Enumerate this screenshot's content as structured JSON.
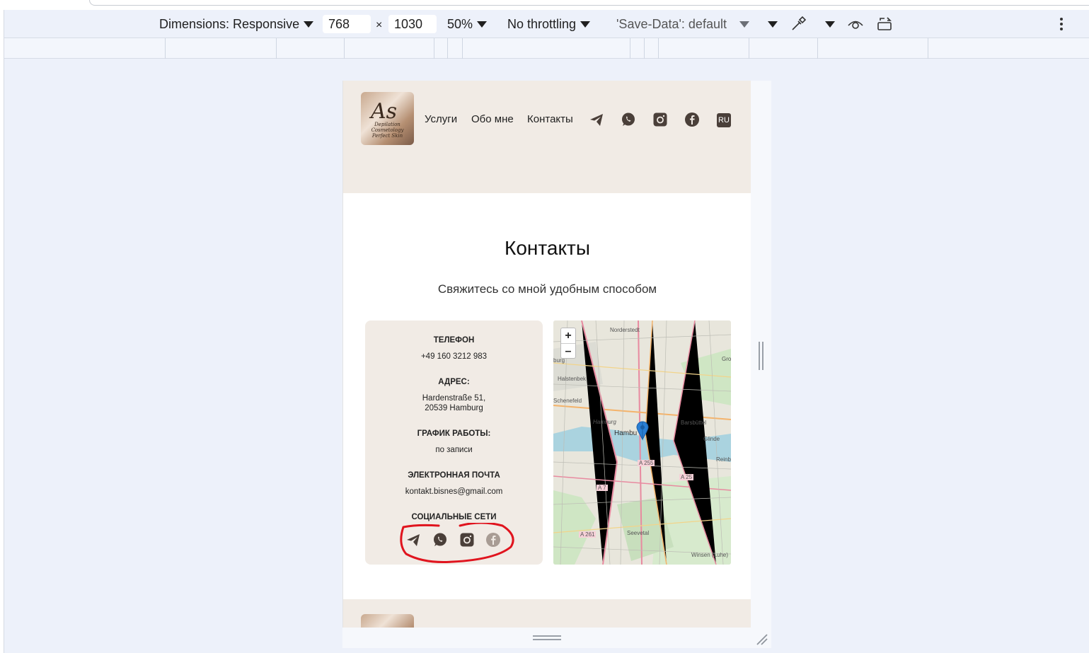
{
  "devtools": {
    "dimensions_label": "Dimensions: Responsive",
    "width_value": "768",
    "times": "×",
    "height_value": "1030",
    "zoom": "50%",
    "throttling": "No throttling",
    "save_data": "'Save-Data': default",
    "more_icon": "kebab-menu-icon"
  },
  "site": {
    "logo": {
      "monogram": "As",
      "tagline": "Depilation Cosmetology Perfect Skin"
    },
    "nav": [
      "Услуги",
      "Обо мне",
      "Контакты"
    ],
    "lang": "RU",
    "title": "Контакты",
    "subtitle": "Свяжитесь со мной удобным способом",
    "contacts": {
      "phone_label": "ТЕЛЕФОН",
      "phone": "+49 160 3212 983",
      "address_label": "АДРЕС:",
      "address_line1": "Hardenstraße 51,",
      "address_line2": "20539 Hamburg",
      "hours_label": "ГРАФИК РАБОТЫ:",
      "hours": "по записи",
      "email_label": "ЭЛЕКТРОННАЯ ПОЧТА",
      "email": "kontakt.bisnes@gmail.com",
      "social_label": "СОЦИАЛЬНЫЕ СЕТИ"
    },
    "map": {
      "zoom_in": "+",
      "zoom_out": "–",
      "labels": [
        "Norderstedt",
        "Halstenbek",
        "Schenefeld",
        "Hamburg",
        "Hambu",
        "Barsbüttel",
        "Glinde",
        "Reinb",
        "A 255",
        "A 25",
        "A 7",
        "A 261",
        "Seevetal",
        "Winsen (Luhe)",
        "Gro",
        "burg"
      ]
    },
    "colors": {
      "header_bg": "#f1ebe5",
      "icon": "#4a3f39",
      "annotation": "#e0141e",
      "marker": "#2a7fd4"
    }
  }
}
